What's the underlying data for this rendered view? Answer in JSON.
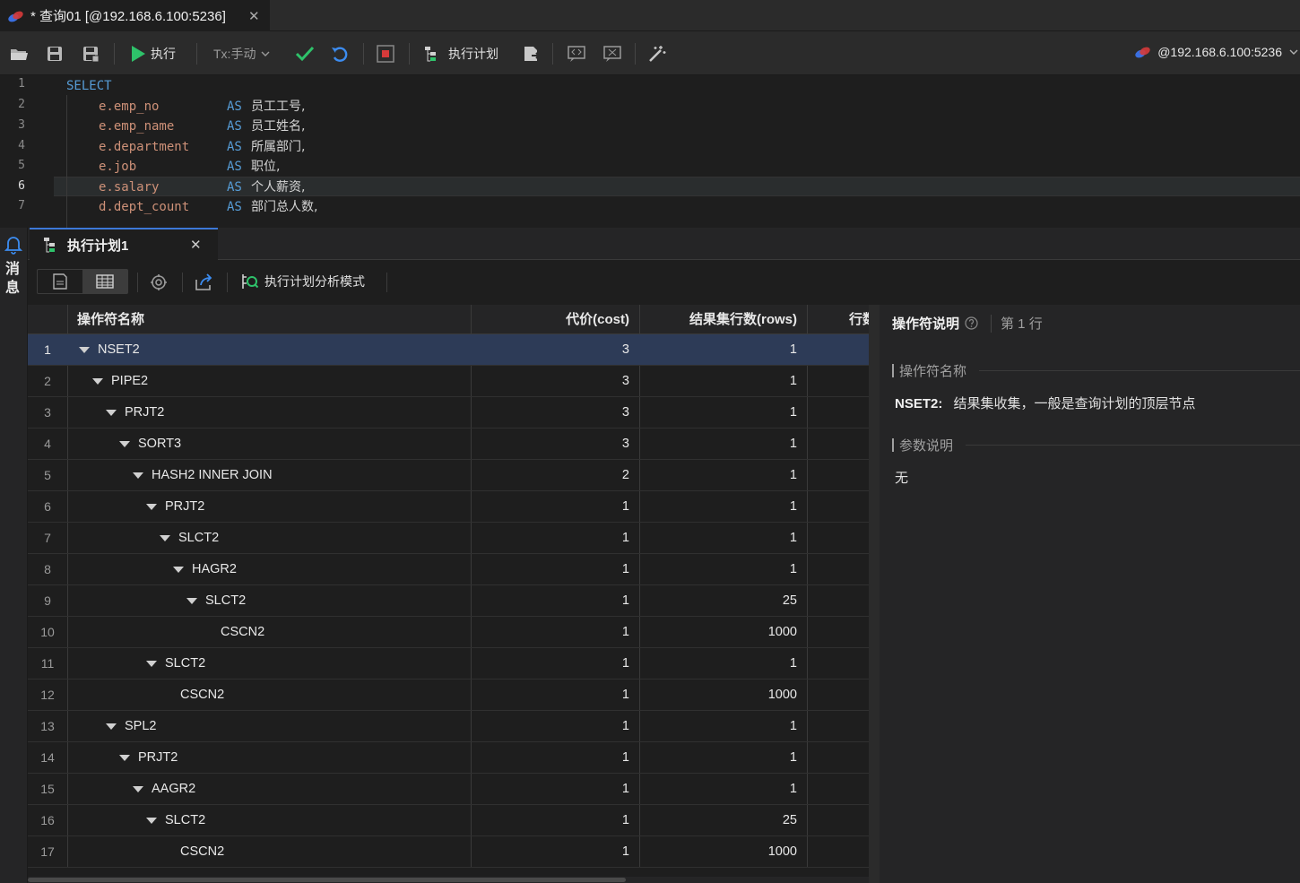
{
  "tab": {
    "title": "* 查询01 [@192.168.6.100:5236]"
  },
  "toolbar": {
    "run_label": "执行",
    "tx_label": "Tx:手动",
    "plan_label": "执行计划",
    "connection": "@192.168.6.100:5236"
  },
  "editor": {
    "lines": [
      {
        "num": "1",
        "a": "SELECT",
        "b": "",
        "c": ""
      },
      {
        "num": "2",
        "a": "e.emp_no",
        "b": "AS",
        "c": "员工工号,"
      },
      {
        "num": "3",
        "a": "e.emp_name",
        "b": "AS",
        "c": "员工姓名,"
      },
      {
        "num": "4",
        "a": "e.department",
        "b": "AS",
        "c": "所属部门,"
      },
      {
        "num": "5",
        "a": "e.job",
        "b": "AS",
        "c": "职位,"
      },
      {
        "num": "6",
        "a": "e.salary",
        "b": "AS",
        "c": "个人薪资,"
      },
      {
        "num": "7",
        "a": "d.dept_count",
        "b": "AS",
        "c": "部门总人数,"
      }
    ]
  },
  "sidebar": {
    "messages_label": "消息"
  },
  "result": {
    "tab_label": "执行计划1",
    "analyze_label": "执行计划分析模式",
    "columns": {
      "op": "操作符名称",
      "cost": "代价(cost)",
      "rows": "结果集行数(rows)",
      "more": "行数"
    },
    "rows": [
      {
        "n": "1",
        "op": "NSET2",
        "cost": "3",
        "rows": "1"
      },
      {
        "n": "2",
        "op": "PIPE2",
        "cost": "3",
        "rows": "1"
      },
      {
        "n": "3",
        "op": "PRJT2",
        "cost": "3",
        "rows": "1"
      },
      {
        "n": "4",
        "op": "SORT3",
        "cost": "3",
        "rows": "1"
      },
      {
        "n": "5",
        "op": "HASH2 INNER JOIN",
        "cost": "2",
        "rows": "1"
      },
      {
        "n": "6",
        "op": "PRJT2",
        "cost": "1",
        "rows": "1"
      },
      {
        "n": "7",
        "op": "SLCT2",
        "cost": "1",
        "rows": "1"
      },
      {
        "n": "8",
        "op": "HAGR2",
        "cost": "1",
        "rows": "1"
      },
      {
        "n": "9",
        "op": "SLCT2",
        "cost": "1",
        "rows": "25"
      },
      {
        "n": "10",
        "op": "CSCN2",
        "cost": "1",
        "rows": "1000"
      },
      {
        "n": "11",
        "op": "SLCT2",
        "cost": "1",
        "rows": "1"
      },
      {
        "n": "12",
        "op": "CSCN2",
        "cost": "1",
        "rows": "1000"
      },
      {
        "n": "13",
        "op": "SPL2",
        "cost": "1",
        "rows": "1"
      },
      {
        "n": "14",
        "op": "PRJT2",
        "cost": "1",
        "rows": "1"
      },
      {
        "n": "15",
        "op": "AAGR2",
        "cost": "1",
        "rows": "1"
      },
      {
        "n": "16",
        "op": "SLCT2",
        "cost": "1",
        "rows": "25"
      },
      {
        "n": "17",
        "op": "CSCN2",
        "cost": "1",
        "rows": "1000"
      }
    ]
  },
  "detail": {
    "title": "操作符说明",
    "row_label": "第 1 行",
    "sec_name": "操作符名称",
    "op_name": "NSET2:",
    "op_desc": "结果集收集，一般是查询计划的顶层节点",
    "sec_params": "参数说明",
    "params": "无"
  }
}
